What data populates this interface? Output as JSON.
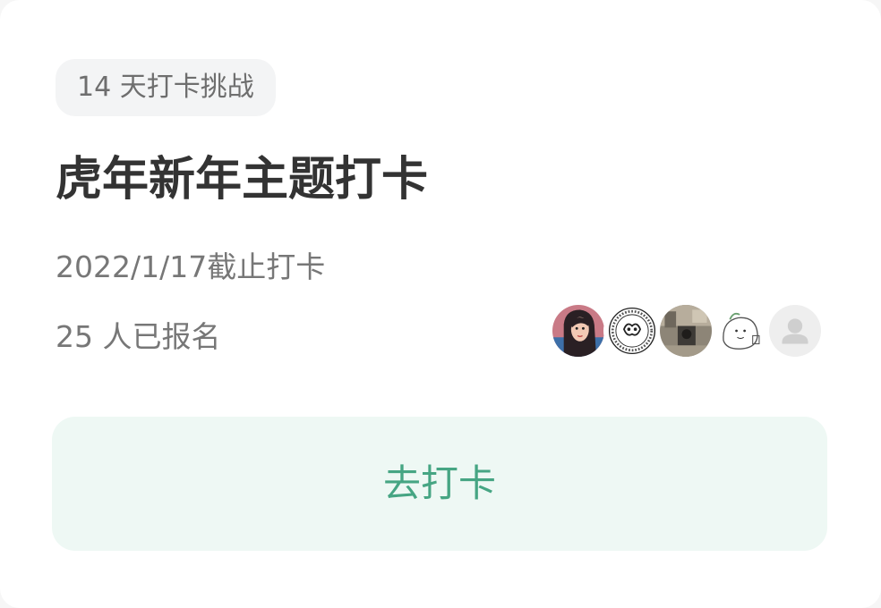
{
  "card": {
    "tag_label": "14 天打卡挑战",
    "title": "虎年新年主题打卡",
    "deadline": "2022/1/17截止打卡",
    "participants_text": "25 人已报名",
    "avatars": [
      {
        "icon": "portrait-avatar"
      },
      {
        "icon": "emblem-avatar"
      },
      {
        "icon": "photo-avatar"
      },
      {
        "icon": "sketch-avatar"
      },
      {
        "icon": "default-user-icon"
      }
    ],
    "cta_label": "去打卡"
  },
  "colors": {
    "accent": "#46a583",
    "cta_background": "#eef8f4",
    "title_text": "#333333",
    "secondary_text": "#777777",
    "tag_background": "#f3f4f5"
  }
}
